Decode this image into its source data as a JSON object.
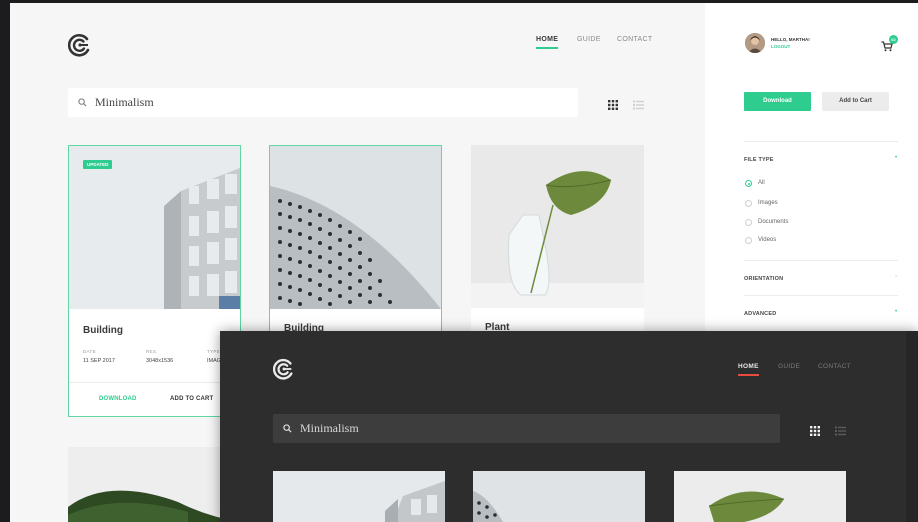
{
  "light": {
    "nav": {
      "home": "HOME",
      "guide": "GUIDE",
      "contact": "CONTACT"
    },
    "search": {
      "query": "Minimalism"
    },
    "cards": [
      {
        "badge": "UPDATED",
        "title": "Building",
        "meta": [
          {
            "label": "DATE",
            "value": "11 SEP 2017"
          },
          {
            "label": "RES.",
            "value": "3048x1536"
          },
          {
            "label": "TYPE",
            "value": "IMAG"
          }
        ],
        "download": "DOWNLOAD",
        "add_to_cart": "ADD TO CART"
      },
      {
        "title": "Building"
      },
      {
        "title": "Plant"
      }
    ],
    "sidebar": {
      "greeting": "HELLO, MARTHA!",
      "logout": "LOGOUT",
      "cart_count": "02",
      "download_btn": "Download",
      "add_to_cart_btn": "Add to Cart",
      "file_type": {
        "heading": "FILE TYPE",
        "options": [
          "All",
          "Images",
          "Documents",
          "Videos"
        ],
        "selected": "All"
      },
      "orientation": "ORIENTATION",
      "advanced": "ADVANCED"
    },
    "accent": "#2ecc8f"
  },
  "dark": {
    "nav": {
      "home": "HOME",
      "guide": "GUIDE",
      "contact": "CONTACT"
    },
    "search": {
      "query": "Minimalism"
    },
    "accent": "#e74c3c"
  },
  "icons": [
    "logo-icon",
    "search-icon",
    "grid-view-icon",
    "list-view-icon",
    "cart-icon",
    "avatar"
  ]
}
